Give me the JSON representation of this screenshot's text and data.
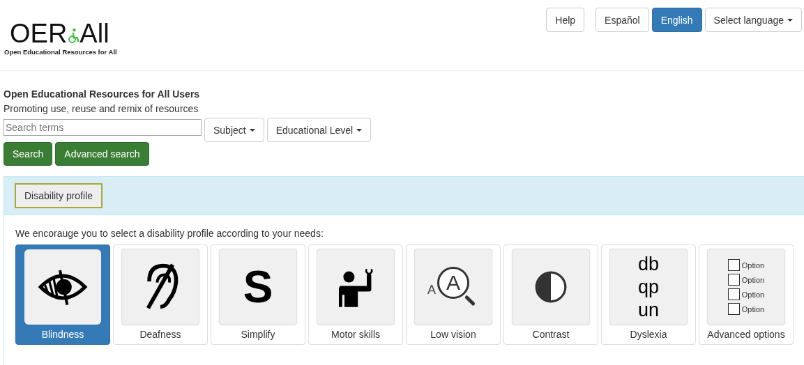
{
  "logo": {
    "left": "OER",
    "right": "All",
    "tagline": "Open Educational Resources for All"
  },
  "top_buttons": [
    {
      "label": "Help",
      "kind": "plain",
      "selected": false
    },
    {
      "label": "Español",
      "kind": "plain",
      "selected": false
    },
    {
      "label": "English",
      "kind": "plain",
      "selected": true
    },
    {
      "label": "Select language",
      "kind": "dropdown",
      "selected": false
    }
  ],
  "intro": {
    "title": "Open Educational Resources for All Users",
    "subtitle": "Promoting use, reuse and remix of resources"
  },
  "search": {
    "placeholder": "Search terms",
    "filters": [
      "Subject",
      "Educational Level"
    ],
    "buttons": [
      "Search",
      "Advanced search"
    ]
  },
  "panel": {
    "tab": "Disability profile",
    "prompt": "We encorauge you to select a disability profile according to your needs:",
    "profiles": [
      {
        "label": "Blindness",
        "kind": "eye",
        "selected": true
      },
      {
        "label": "Deafness",
        "kind": "ear",
        "selected": false
      },
      {
        "label": "Simplify",
        "kind": "glyph",
        "icon_text": [
          "S"
        ],
        "selected": false
      },
      {
        "label": "Motor skills",
        "kind": "person",
        "selected": false
      },
      {
        "label": "Low vision",
        "kind": "magnifier",
        "icon_text": [
          "A",
          "A"
        ],
        "selected": false
      },
      {
        "label": "Contrast",
        "kind": "contrast",
        "selected": false
      },
      {
        "label": "Dyslexia",
        "kind": "glyph",
        "icon_text": [
          "db",
          "qp",
          "un"
        ],
        "selected": false
      },
      {
        "label": "Advanced options",
        "kind": "checklist",
        "icon_text": [
          "Option",
          "Option",
          "Option",
          "Option"
        ],
        "selected": false
      }
    ]
  }
}
